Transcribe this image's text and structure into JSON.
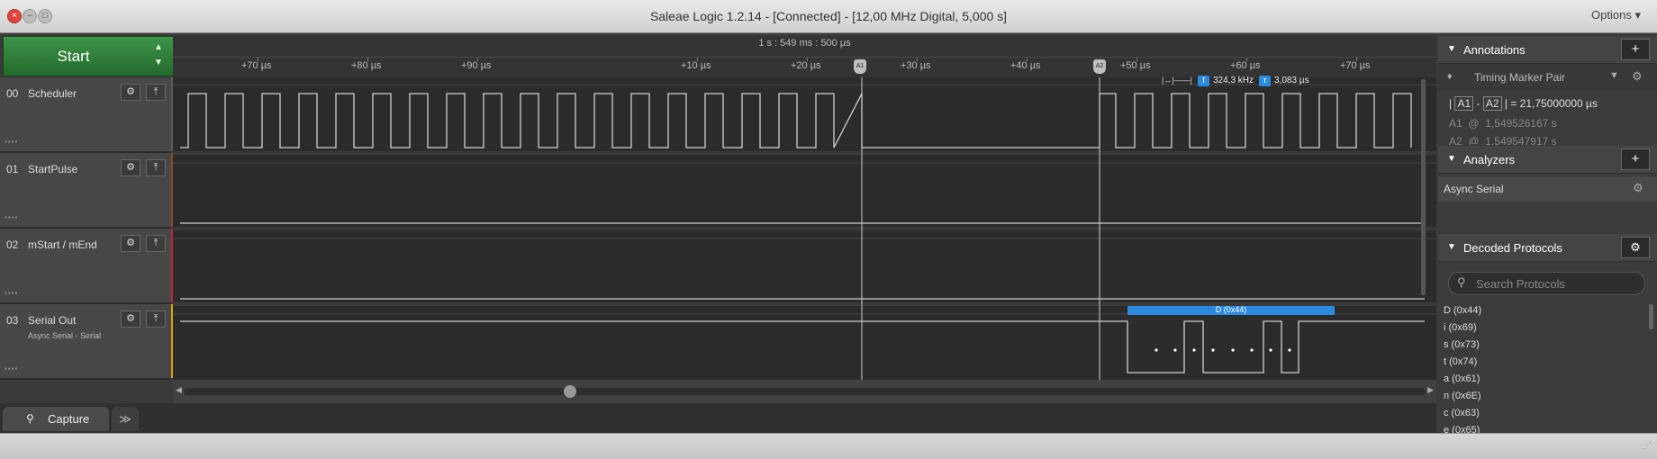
{
  "window": {
    "title": "Saleae Logic 1.2.14 - [Connected] - [12,00 MHz Digital, 5,000 s]",
    "options_label": "Options ▾"
  },
  "start": {
    "label": "Start"
  },
  "timeline": {
    "absolute_time": "1 s : 549 ms : 500 µs",
    "ticks": [
      "+70 µs",
      "+80 µs",
      "+90 µs",
      "+10 µs",
      "+20 µs",
      "+30 µs",
      "+40 µs",
      "+50 µs",
      "+60 µs",
      "+70 µs"
    ],
    "marker_a1": "A1",
    "marker_a2": "A2",
    "measure_freq": "324,3 kHz",
    "measure_period": "3,083 µs",
    "freq_badge": "f",
    "period_badge": "τ"
  },
  "channels": [
    {
      "num": "00",
      "name": "Scheduler",
      "sub": "",
      "color": "#5a5a5a"
    },
    {
      "num": "01",
      "name": "StartPulse",
      "sub": "",
      "color": "#8a4a1e"
    },
    {
      "num": "02",
      "name": "mStart / mEnd",
      "sub": "",
      "color": "#c0232c"
    },
    {
      "num": "03",
      "name": "Serial Out",
      "sub": "Async Serial - Serial",
      "color": "#d8a300"
    }
  ],
  "decode_bubble": {
    "label": "D (0x44)"
  },
  "tabs": {
    "capture": "Capture",
    "more": "≫"
  },
  "annotations": {
    "title": "Annotations",
    "add": "+",
    "pair": "Timing Marker Pair",
    "diff_a1": "A1",
    "diff_a2": "A2",
    "diff_value": "= 21,75000000 µs",
    "a1_label": "A1",
    "a1_at": "@",
    "a1_value": "1,549526167 s",
    "a2_label": "A2",
    "a2_at": "@",
    "a2_value": "1,549547917 s"
  },
  "analyzers": {
    "title": "Analyzers",
    "add": "+",
    "items": [
      "Async Serial"
    ]
  },
  "decoded": {
    "title": "Decoded Protocols",
    "search_placeholder": "Search Protocols",
    "items": [
      "D (0x44)",
      "i (0x69)",
      "s (0x73)",
      "t (0x74)",
      "a (0x61)",
      "n (0x6E)",
      "c (0x63)",
      "e (0x65)"
    ]
  }
}
